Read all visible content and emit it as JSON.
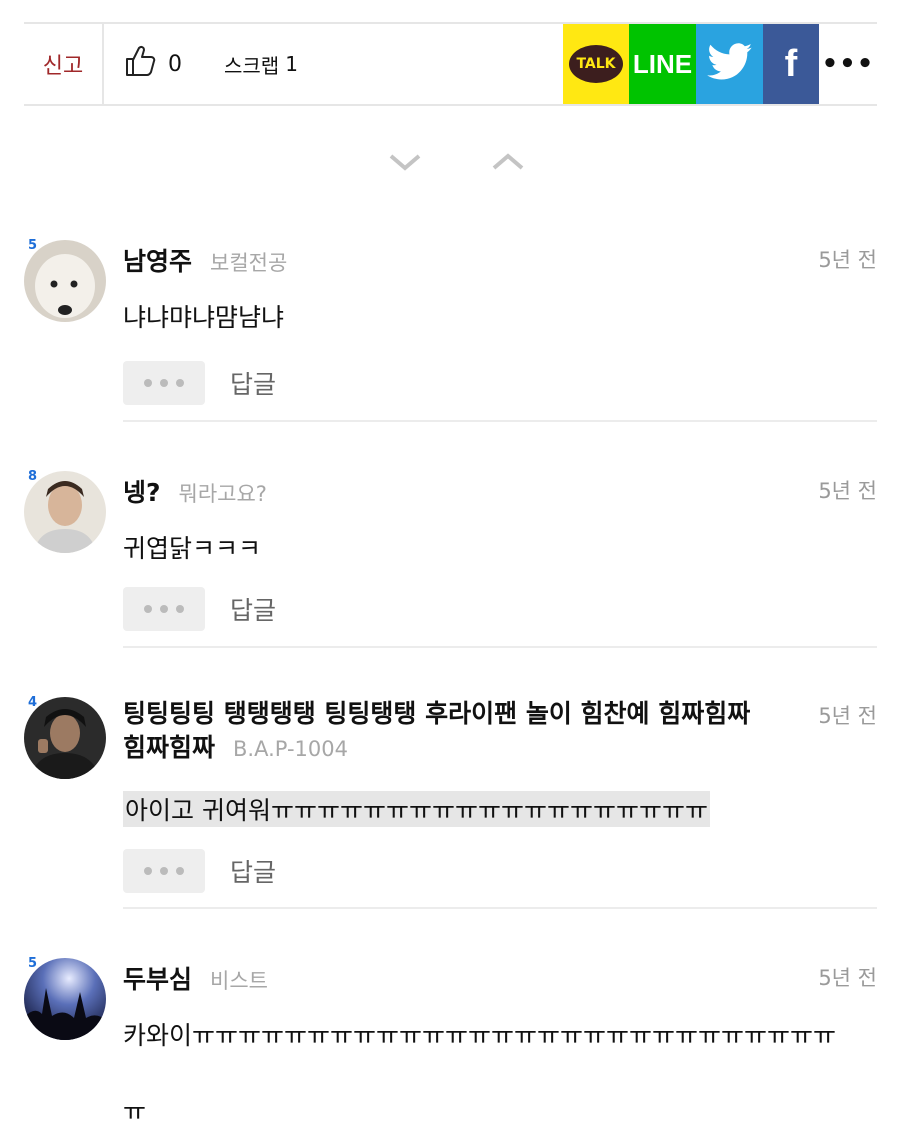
{
  "action_bar": {
    "report_label": "신고",
    "like_count": "0",
    "scrap_label": "스크랩",
    "scrap_count": "1",
    "kakao_label": "TALK",
    "line_label": "LINE",
    "facebook_label": "f",
    "more_label": "•••"
  },
  "colors": {
    "kakao": "#ffe812",
    "line": "#00c300",
    "twitter": "#2aa3e0",
    "facebook": "#3b5998",
    "report": "#a0282a"
  },
  "comments": [
    {
      "level": "5",
      "nickname": "남영주",
      "group": "보컬전공",
      "time": "5년 전",
      "text": "냐냐먀냐먐냠냐",
      "reply_label": "답글",
      "avatar_icon": "white-dog-avatar"
    },
    {
      "level": "8",
      "nickname": "넹?",
      "group": "뭐라고요?",
      "time": "5년 전",
      "text": "귀엽닭ㅋㅋㅋ",
      "reply_label": "답글",
      "avatar_icon": "man-portrait-avatar"
    },
    {
      "level": "4",
      "nickname_line1": "팅팅팅팅 탱탱탱탱 팅팅탱탱 후라이팬 놀이 힘찬예 힘짜힘짜",
      "nickname_line2": "힘짜힘짜",
      "group": "B.A.P-1004",
      "time": "5년 전",
      "text": "아이고 귀여워ㅠㅠㅠㅠㅠㅠㅠㅠㅠㅠㅠㅠㅠㅠㅠㅠㅠㅠㅠ",
      "reply_label": "답글",
      "avatar_icon": "dark-portrait-avatar"
    },
    {
      "level": "5",
      "nickname": "두부심",
      "group": "비스트",
      "time": "5년 전",
      "text": "카와이ㅠㅠㅠㅠㅠㅠㅠㅠㅠㅠㅠㅠㅠㅠㅠㅠㅠㅠㅠㅠㅠㅠㅠㅠㅠㅠㅠㅠ",
      "text_line2": "ㅠ",
      "avatar_icon": "concert-avatar"
    }
  ]
}
